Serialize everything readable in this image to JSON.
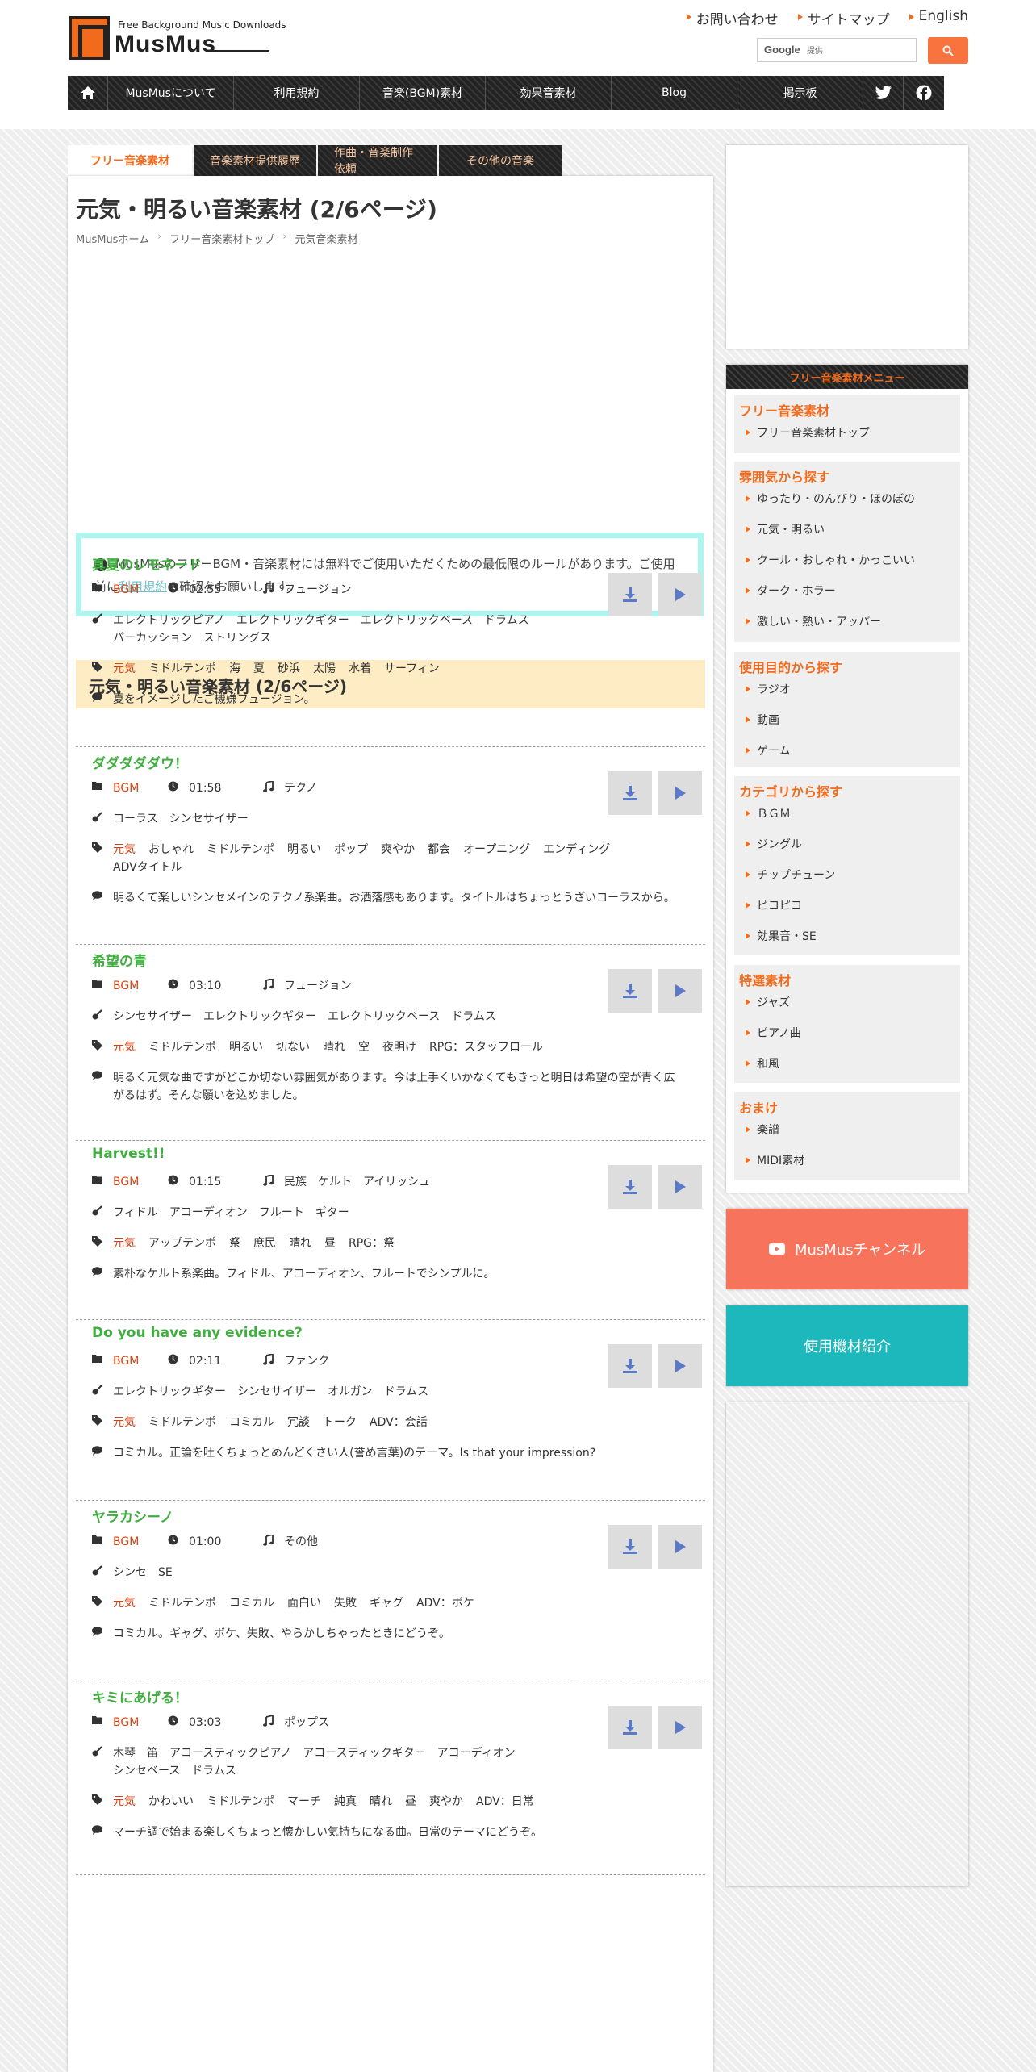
{
  "header": {
    "tagline": "Free Background Music Downloads",
    "logo_text": "MusMus",
    "top_links": [
      "お問い合わせ",
      "サイトマップ",
      "English"
    ],
    "search_brand": "Google",
    "search_sub": "提供"
  },
  "nav": {
    "items": [
      "MusMusについて",
      "利用規約",
      "音楽(BGM)素材",
      "効果音素材",
      "Blog",
      "掲示板"
    ]
  },
  "tabs": [
    "フリー音楽素材",
    "音楽素材提供履歴",
    "作曲・音楽制作依頼",
    "その他の音楽"
  ],
  "main": {
    "title": "元気・明るい音楽素材 (2/6ページ)",
    "breadcrumb": [
      "MusMusホーム",
      "フリー音楽素材トップ",
      "元気音楽素材"
    ],
    "notice_before": "MusMusのフリーBGM・音楽素材には無料でご使用いただくための最低限のルールがあります。ご使用前に",
    "notice_link": "利用規約",
    "notice_after": "の確認をお願いします。",
    "section_title": "元気・明るい音楽素材 (2/6ページ)"
  },
  "tracks": [
    {
      "name": "真夏のレモネード",
      "category": "BGM",
      "time": "02:55",
      "genre": "フュージョン",
      "instruments": "エレクトリックピアノ　エレクトリックギター　エレクトリックベース　ドラムス\nパーカッション　ストリングス",
      "tags": [
        "元気",
        "ミドルテンポ",
        "海",
        "夏",
        "砂浜",
        "太陽",
        "水着",
        "サーフィン"
      ],
      "desc": "夏をイメージしたご機嫌フュージョン。"
    },
    {
      "name": "ダダダダダウ！",
      "category": "BGM",
      "time": "01:58",
      "genre": "テクノ",
      "instruments": "コーラス　シンセサイザー",
      "tags": [
        "元気",
        "おしゃれ",
        "ミドルテンポ",
        "明るい",
        "ポップ",
        "爽やか",
        "都会",
        "オープニング",
        "エンディング",
        "ADVタイトル"
      ],
      "desc": "明るくて楽しいシンセメインのテクノ系楽曲。お洒落感もあります。タイトルはちょっとうざいコーラスから。"
    },
    {
      "name": "希望の青",
      "category": "BGM",
      "time": "03:10",
      "genre": "フュージョン",
      "instruments": "シンセサイザー　エレクトリックギター　エレクトリックベース　ドラムス",
      "tags": [
        "元気",
        "ミドルテンポ",
        "明るい",
        "切ない",
        "晴れ",
        "空",
        "夜明け",
        "RPG：スタッフロール"
      ],
      "desc": "明るく元気な曲ですがどこか切ない雰囲気があります。今は上手くいかなくてもきっと明日は希望の空が青く広がるはず。そんな願いを込めました。"
    },
    {
      "name": "Harvest!!",
      "category": "BGM",
      "time": "01:15",
      "genre": "民族　ケルト　アイリッシュ",
      "instruments": "フィドル　アコーディオン　フルート　ギター",
      "tags": [
        "元気",
        "アップテンポ",
        "祭",
        "庶民",
        "晴れ",
        "昼",
        "RPG：祭"
      ],
      "desc": "素朴なケルト系楽曲。フィドル、アコーディオン、フルートでシンプルに。"
    },
    {
      "name": "Do you have any evidence?",
      "category": "BGM",
      "time": "02:11",
      "genre": "ファンク",
      "instruments": "エレクトリックギター　シンセサイザー　オルガン　ドラムス",
      "tags": [
        "元気",
        "ミドルテンポ",
        "コミカル",
        "冗談",
        "トーク",
        "ADV：会話"
      ],
      "desc": "コミカル。正論を吐くちょっとめんどくさい人(誉め言葉)のテーマ。Is that your impression?"
    },
    {
      "name": "ヤラカシーノ",
      "category": "BGM",
      "time": "01:00",
      "genre": "その他",
      "instruments": "シンセ　SE",
      "tags": [
        "元気",
        "ミドルテンポ",
        "コミカル",
        "面白い",
        "失敗",
        "ギャグ",
        "ADV：ボケ"
      ],
      "desc": "コミカル。ギャグ、ボケ、失敗、やらかしちゃったときにどうぞ。"
    },
    {
      "name": "キミにあげる！",
      "category": "BGM",
      "time": "03:03",
      "genre": "ポップス",
      "instruments": "木琴　笛　アコースティックピアノ　アコースティックギター　アコーディオン\nシンセベース　ドラムス",
      "tags": [
        "元気",
        "かわいい",
        "ミドルテンポ",
        "マーチ",
        "純真",
        "晴れ",
        "昼",
        "爽やか",
        "ADV：日常"
      ],
      "desc": "マーチ調で始まる楽しくちょっと懐かしい気持ちになる曲。日常のテーマにどうぞ。"
    }
  ],
  "sidebar": {
    "menu_header": "フリー音楽素材メニュー",
    "groups": [
      {
        "title": "フリー音楽素材",
        "items": [
          "フリー音楽素材トップ"
        ]
      },
      {
        "title": "雰囲気から探す",
        "items": [
          "ゆったり・のんびり・ほのぼの",
          "元気・明るい",
          "クール・おしゃれ・かっこいい",
          "ダーク・ホラー",
          "激しい・熱い・アッパー"
        ]
      },
      {
        "title": "使用目的から探す",
        "items": [
          "ラジオ",
          "動画",
          "ゲーム"
        ]
      },
      {
        "title": "カテゴリから探す",
        "items": [
          "ＢＧＭ",
          "ジングル",
          "チップチューン",
          "ピコピコ",
          "効果音・SE"
        ]
      },
      {
        "title": "特選素材",
        "items": [
          "ジャズ",
          "ピアノ曲",
          "和風"
        ]
      },
      {
        "title": "おまけ",
        "items": [
          "楽譜",
          "MIDI素材"
        ]
      }
    ],
    "youtube_label": "MusMusチャンネル",
    "equipment_label": "使用機材紹介"
  },
  "colors": {
    "accent": "#f26b1d",
    "track_title": "#3fae3f",
    "notice_border": "#aef5ef",
    "section_bg": "#feecc4",
    "youtube_bg": "#f7735c",
    "equipment_bg": "#1db8bc"
  }
}
